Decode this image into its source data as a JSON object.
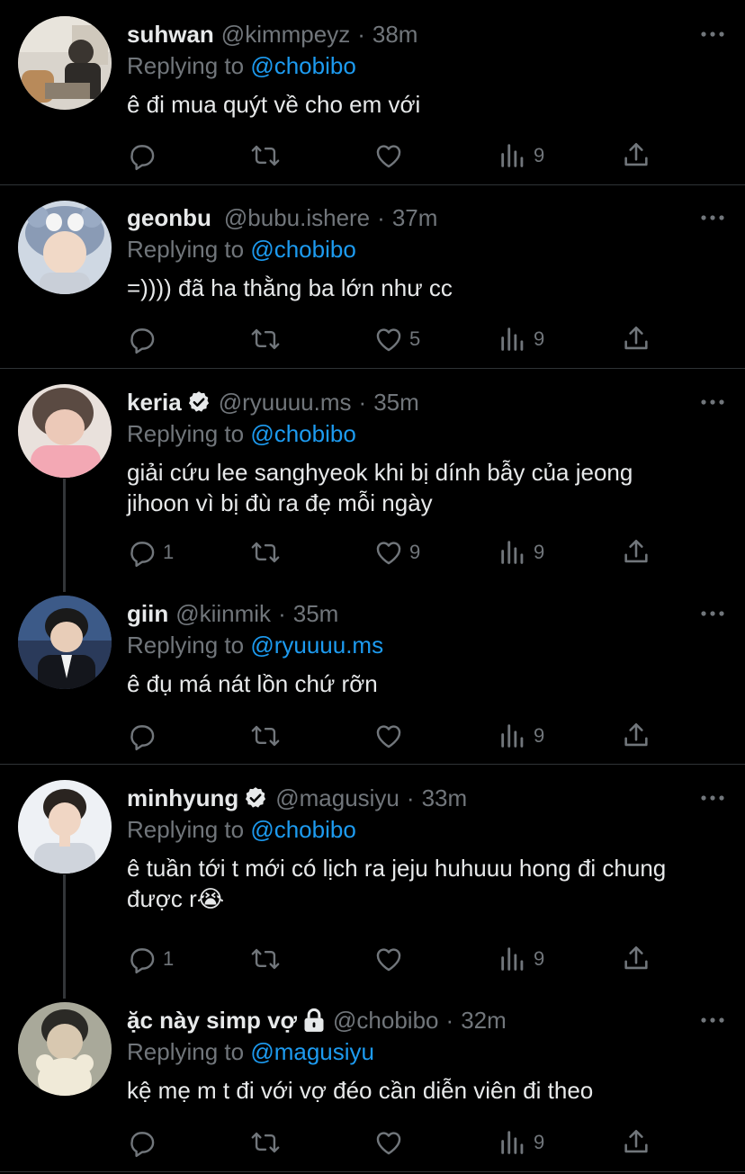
{
  "reply_prefix": "Replying to",
  "tweets": [
    {
      "name": "suhwan",
      "handle": "@kimmpeyz",
      "time": "38m",
      "reply_to": "@chobibo",
      "text": "ê đi mua quýt về cho em với",
      "verified": false,
      "protected": false,
      "replies": "",
      "retweets": "",
      "likes": "",
      "views": "9"
    },
    {
      "name": "geonbu",
      "handle": "@bubu.ishere",
      "time": "37m",
      "reply_to": "@chobibo",
      "text": "=)))) đã ha thằng ba lớn như cc",
      "verified": false,
      "protected": false,
      "replies": "",
      "retweets": "",
      "likes": "5",
      "views": "9"
    },
    {
      "name": "keria",
      "handle": "@ryuuuu.ms",
      "time": "35m",
      "reply_to": "@chobibo",
      "text_lines": [
        "giải cứu lee sanghyeok khi bị dính bẫy của jeong",
        "jihoon vì bị đù ra đẹ mỗi ngày"
      ],
      "verified": true,
      "protected": false,
      "replies": "1",
      "retweets": "",
      "likes": "9",
      "views": "9"
    },
    {
      "name": "giin",
      "handle": "@kiinmik",
      "time": "35m",
      "reply_to": "@ryuuuu.ms",
      "text": "ê đụ má nát lồn chứ rỡn",
      "verified": false,
      "protected": false,
      "replies": "",
      "retweets": "",
      "likes": "",
      "views": "9"
    },
    {
      "name": "minhyung",
      "handle": "@magusiyu",
      "time": "33m",
      "reply_to": "@chobibo",
      "text_lines": [
        "ê tuần tới t mới có lịch ra jeju huhuuu hong đi chung",
        "được r😭"
      ],
      "verified": true,
      "protected": false,
      "replies": "1",
      "retweets": "",
      "likes": "",
      "views": "9"
    },
    {
      "name": "ặc này simp vợ",
      "handle": "@chobibo",
      "time": "32m",
      "reply_to": "@magusiyu",
      "text": "kệ mẹ m t đi với vợ đéo cần diễn viên đi theo",
      "verified": false,
      "protected": true,
      "replies": "",
      "retweets": "",
      "likes": "",
      "views": "9"
    }
  ],
  "icons": {
    "reply": "reply-icon",
    "retweet": "retweet-icon",
    "like": "heart-icon",
    "views": "views-icon",
    "share": "share-icon",
    "more": "more-icon",
    "verified": "verified-badge-icon",
    "protected": "lock-icon"
  },
  "colors": {
    "background": "#000000",
    "text": "#e7e9ea",
    "secondary": "#71767b",
    "accent": "#1d9bf0",
    "divider": "#2f3336"
  }
}
